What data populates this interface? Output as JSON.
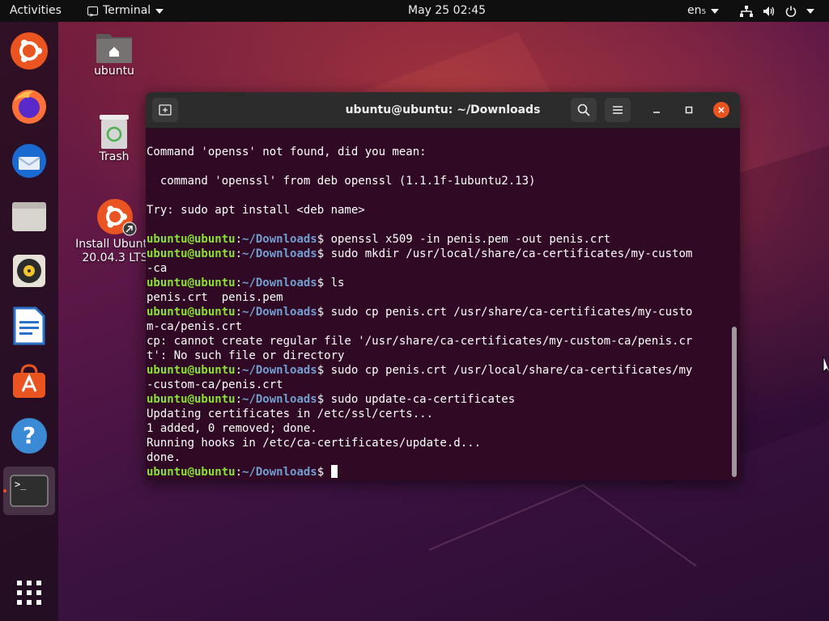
{
  "topbar": {
    "activities": "Activities",
    "app_menu": "Terminal",
    "clock": "May 25  02:45",
    "language": "en₅"
  },
  "dock": {
    "items": [
      {
        "name": "ubuntu-installer",
        "icon": "ubuntu-installer-icon"
      },
      {
        "name": "firefox",
        "icon": "firefox-icon"
      },
      {
        "name": "thunderbird",
        "icon": "thunderbird-icon"
      },
      {
        "name": "files",
        "icon": "files-icon"
      },
      {
        "name": "rhythmbox",
        "icon": "rhythmbox-icon"
      },
      {
        "name": "libreoffice-writer",
        "icon": "writer-icon"
      },
      {
        "name": "ubuntu-software",
        "icon": "software-icon"
      },
      {
        "name": "help",
        "icon": "help-icon"
      },
      {
        "name": "terminal",
        "icon": "terminal-icon",
        "active": true
      }
    ],
    "show_apps_icon": "app-grid-icon"
  },
  "desktop": {
    "home_label": "ubuntu",
    "trash_label": "Trash",
    "install_label_1": "Install Ubuntu",
    "install_label_2": "20.04.3 LTS"
  },
  "terminal": {
    "title": "ubuntu@ubuntu: ~/Downloads",
    "prompt_user": "ubuntu@ubuntu",
    "prompt_sep": ":",
    "prompt_path": "~/Downloads",
    "prompt_end": "$ ",
    "lines": [
      {
        "text": "Command 'openss' not found, did you mean:"
      },
      {
        "text": ""
      },
      {
        "text": "  command 'openssl' from deb openssl (1.1.1f-1ubuntu2.13)"
      },
      {
        "text": ""
      },
      {
        "text": "Try: sudo apt install <deb name>"
      },
      {
        "text": ""
      },
      {
        "prompt": true,
        "cmd": "openssl x509 -in penis.pem -out penis.crt"
      },
      {
        "prompt": true,
        "cmd": "sudo mkdir /usr/local/share/ca-certificates/my-custom"
      },
      {
        "text": "-ca"
      },
      {
        "prompt": true,
        "cmd": "ls"
      },
      {
        "text": "penis.crt  penis.pem"
      },
      {
        "prompt": true,
        "cmd": "sudo cp penis.crt /usr/share/ca-certificates/my-custo"
      },
      {
        "text": "m-ca/penis.crt"
      },
      {
        "text": "cp: cannot create regular file '/usr/share/ca-certificates/my-custom-ca/penis.cr"
      },
      {
        "text": "t': No such file or directory"
      },
      {
        "prompt": true,
        "cmd": "sudo cp penis.crt /usr/local/share/ca-certificates/my"
      },
      {
        "text": "-custom-ca/penis.crt"
      },
      {
        "prompt": true,
        "cmd": "sudo update-ca-certificates"
      },
      {
        "text": "Updating certificates in /etc/ssl/certs..."
      },
      {
        "text": "1 added, 0 removed; done."
      },
      {
        "text": "Running hooks in /etc/ca-certificates/update.d..."
      },
      {
        "text": "done."
      },
      {
        "prompt": true,
        "cmd": "",
        "cursor": true
      }
    ]
  }
}
